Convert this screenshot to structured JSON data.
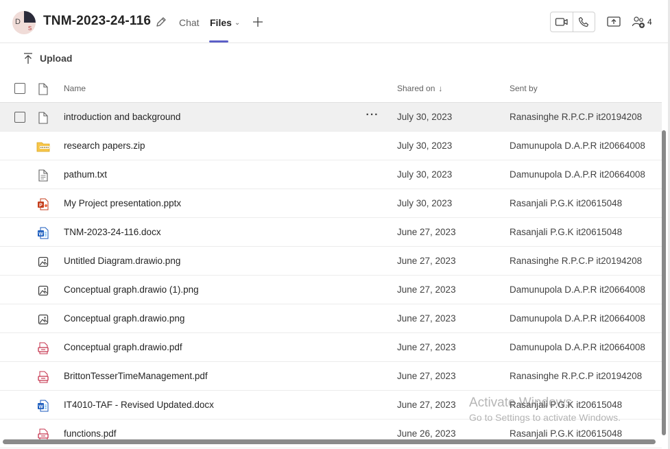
{
  "header": {
    "avatar_initials": [
      "D",
      "",
      "S"
    ],
    "title": "TNM-2023-24-116",
    "tabs": [
      {
        "label": "Chat"
      },
      {
        "label": "Files",
        "active": true
      }
    ],
    "participant_count": "4",
    "accent_color": "#5b5fc7"
  },
  "toolbar": {
    "upload_label": "Upload"
  },
  "table": {
    "columns": {
      "name": "Name",
      "shared_on": "Shared on",
      "sent_by": "Sent by"
    },
    "sort": "descending",
    "rows": [
      {
        "icon": "generic-file-icon",
        "name": "introduction and background",
        "shared_on": "July 30, 2023",
        "sent_by": "Ranasinghe R.P.C.P it20194208",
        "selected": true
      },
      {
        "icon": "zip-folder-icon",
        "name": "research papers.zip",
        "shared_on": "July 30, 2023",
        "sent_by": "Damunupola D.A.P.R it20664008"
      },
      {
        "icon": "text-file-icon",
        "name": "pathum.txt",
        "shared_on": "July 30, 2023",
        "sent_by": "Damunupola D.A.P.R it20664008"
      },
      {
        "icon": "powerpoint-file-icon",
        "name": "My Project presentation.pptx",
        "shared_on": "July 30, 2023",
        "sent_by": "Rasanjali P.G.K it20615048"
      },
      {
        "icon": "word-file-icon",
        "name": "TNM-2023-24-116.docx",
        "shared_on": "June 27, 2023",
        "sent_by": "Rasanjali P.G.K it20615048"
      },
      {
        "icon": "image-file-icon",
        "name": "Untitled Diagram.drawio.png",
        "shared_on": "June 27, 2023",
        "sent_by": "Ranasinghe R.P.C.P it20194208"
      },
      {
        "icon": "image-file-icon",
        "name": "Conceptual graph.drawio (1).png",
        "shared_on": "June 27, 2023",
        "sent_by": "Damunupola D.A.P.R it20664008"
      },
      {
        "icon": "image-file-icon",
        "name": "Conceptual graph.drawio.png",
        "shared_on": "June 27, 2023",
        "sent_by": "Damunupola D.A.P.R it20664008"
      },
      {
        "icon": "pdf-file-icon",
        "name": "Conceptual graph.drawio.pdf",
        "shared_on": "June 27, 2023",
        "sent_by": "Damunupola D.A.P.R it20664008"
      },
      {
        "icon": "pdf-file-icon",
        "name": "BrittonTesserTimeManagement.pdf",
        "shared_on": "June 27, 2023",
        "sent_by": "Ranasinghe R.P.C.P it20194208"
      },
      {
        "icon": "word-file-icon",
        "name": "IT4010-TAF - Revised Updated.docx",
        "shared_on": "June 27, 2023",
        "sent_by": "Rasanjali P.G.K it20615048"
      },
      {
        "icon": "pdf-file-icon",
        "name": "functions.pdf",
        "shared_on": "June 26, 2023",
        "sent_by": "Rasanjali P.G.K it20615048"
      }
    ]
  },
  "watermark": {
    "line1": "Activate Windows",
    "line2": "Go to Settings to activate Windows."
  }
}
